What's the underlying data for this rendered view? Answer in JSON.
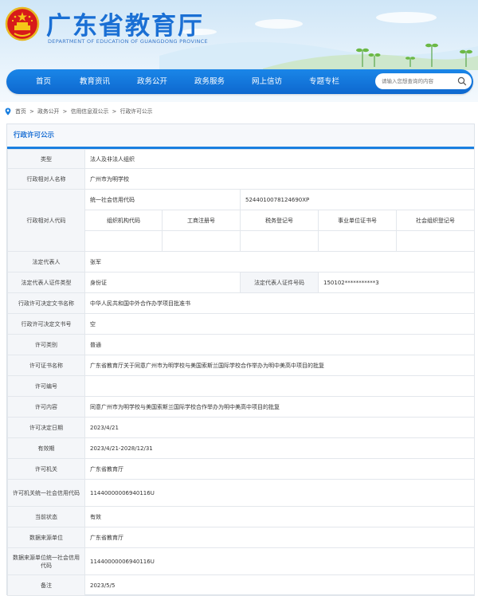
{
  "header": {
    "title": "广东省教育厅",
    "subtitle": "DEPARTMENT OF EDUCATION OF GUANGDONG PROVINCE"
  },
  "nav": {
    "items": [
      "首页",
      "教育资讯",
      "政务公开",
      "政务服务",
      "网上信访",
      "专题专栏"
    ],
    "search_placeholder": "请输入您想查询的内容"
  },
  "breadcrumb": [
    "首页",
    "政务公开",
    "信用信息双公示",
    "行政许可公示"
  ],
  "panel": {
    "title": "行政许可公示",
    "rows": {
      "type": {
        "label": "类型",
        "value": "法人及非法人组织"
      },
      "party_name": {
        "label": "行政相对人名称",
        "value": "广州市为明学校"
      },
      "party_code": {
        "label": "行政相对人代码",
        "credit_code_label": "统一社会信用代码",
        "credit_code_value": "5244010078124690XP",
        "sub_headers": [
          "组织机构代码",
          "工商注册号",
          "税务登记号",
          "事业单位证书号",
          "社会组织登记号"
        ]
      },
      "legal_rep": {
        "label": "法定代表人",
        "value": "张军"
      },
      "legal_rep_id_type": {
        "label": "法定代表人证件类型",
        "value": "身份证",
        "id_number_label": "法定代表人证件号码",
        "id_number_value": "150102***********3"
      },
      "doc_name": {
        "label": "行政许可决定文书名称",
        "value": "中华人民共和国中外合作办学项目批准书"
      },
      "doc_number": {
        "label": "行政许可决定文书号",
        "value": "空"
      },
      "category": {
        "label": "许可类别",
        "value": "普通"
      },
      "cert_name": {
        "label": "许可证书名称",
        "value": "广东省教育厅关于同意广州市为明学校与美国索斯兰国际学校合作举办为明中美高中项目的批复"
      },
      "permit_no": {
        "label": "许可编号",
        "value": ""
      },
      "content": {
        "label": "许可内容",
        "value": "同意广州市为明学校与美国索斯兰国际学校合作举办为明中美高中项目的批复"
      },
      "decision_date": {
        "label": "许可决定日期",
        "value": "2023/4/21"
      },
      "validity": {
        "label": "有效期",
        "value": "2023/4/21-2028/12/31"
      },
      "authority": {
        "label": "许可机关",
        "value": "广东省教育厅"
      },
      "authority_code": {
        "label": "许可机关统一社会信用代码",
        "value": "11440000006940116U"
      },
      "status": {
        "label": "当前状态",
        "value": "有效"
      },
      "source_unit": {
        "label": "数据来源单位",
        "value": "广东省教育厅"
      },
      "source_code": {
        "label": "数据来源单位统一社会信用代码",
        "value": "11440000006940116U"
      },
      "remark": {
        "label": "备注",
        "value": "2023/5/5"
      }
    }
  },
  "colors": {
    "accent": "#1a7fe0",
    "title_blue": "#1a6fd4",
    "nav_blue": "#0e68cf",
    "emblem_red": "#d71a1a"
  }
}
